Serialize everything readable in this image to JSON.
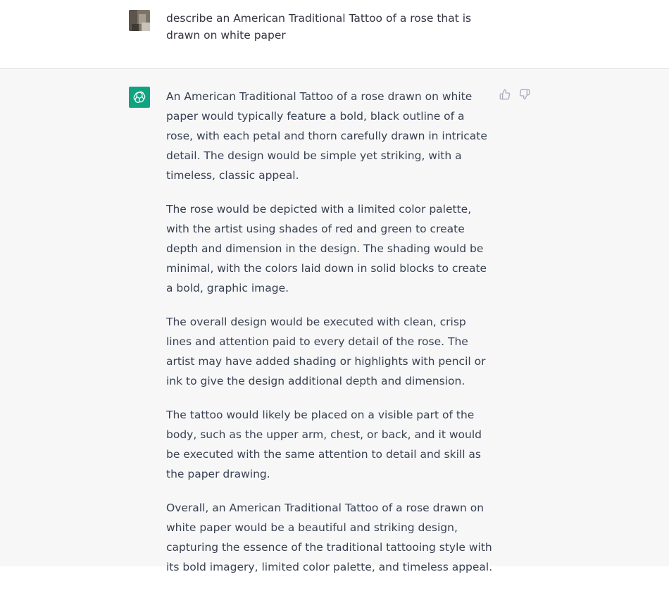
{
  "user_message": {
    "text": "describe an American Traditional Tattoo of a rose that is drawn on white paper",
    "avatar_icon": "user-photo-avatar"
  },
  "assistant_message": {
    "avatar_icon": "openai-logo-icon",
    "accent_color": "#10a37f",
    "paragraphs": [
      "An American Traditional Tattoo of a rose drawn on white paper would typically feature a bold, black outline of a rose, with each petal and thorn carefully drawn in intricate detail. The design would be simple yet striking, with a timeless, classic appeal.",
      "The rose would be depicted with a limited color palette, with the artist using shades of red and green to create depth and dimension in the design. The shading would be minimal, with the colors laid down in solid blocks to create a bold, graphic image.",
      "The overall design would be executed with clean, crisp lines and attention paid to every detail of the rose. The artist may have added shading or highlights with pencil or ink to give the design additional depth and dimension.",
      "The tattoo would likely be placed on a visible part of the body, such as the upper arm, chest, or back, and it would be executed with the same attention to detail and skill as the paper drawing.",
      "Overall, an American Traditional Tattoo of a rose drawn on white paper would be a beautiful and striking design, capturing the essence of the traditional tattooing style with its bold imagery, limited color palette, and timeless appeal."
    ],
    "feedback": {
      "thumbs_up_icon": "thumbs-up-icon",
      "thumbs_down_icon": "thumbs-down-icon"
    }
  }
}
